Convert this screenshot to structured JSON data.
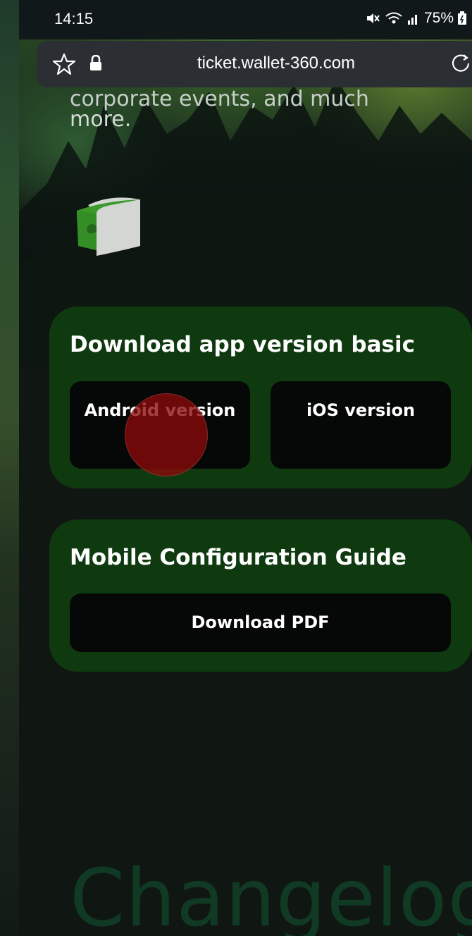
{
  "status_bar": {
    "time": "14:15",
    "battery": "75%"
  },
  "browser": {
    "url": "ticket.wallet-360.com"
  },
  "hero": {
    "clipped_text": "corporate events, and much",
    "text_end": "more."
  },
  "download_card": {
    "title": "Download app version basic",
    "android_label": "Android version",
    "ios_label": "iOS version"
  },
  "guide_card": {
    "title": "Mobile Configuration Guide",
    "pdf_label": "Download PDF"
  },
  "footer": {
    "section_title": "Changelog"
  },
  "colors": {
    "card_bg": "#0f3a0f",
    "button_bg": "#050806",
    "touch_indicator": "#8c0a0a",
    "changelog_text": "#103a24"
  },
  "icons": [
    "star-icon",
    "lock-icon",
    "reload-icon",
    "mute-icon",
    "wifi-icon",
    "signal-icon",
    "battery-icon",
    "wallet-logo-icon"
  ]
}
